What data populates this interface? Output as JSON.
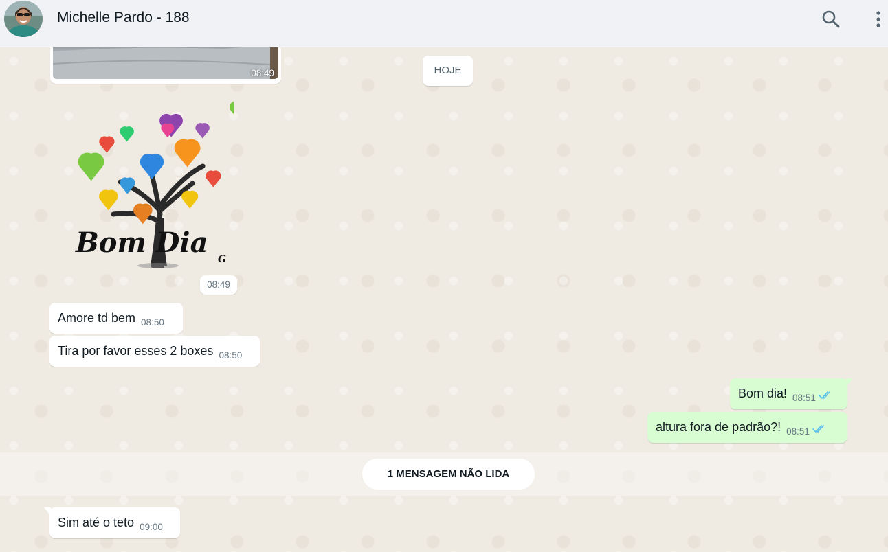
{
  "header": {
    "contact_name": "Michelle Pardo - 188",
    "search_icon": "search-icon",
    "menu_icon": "more-vertical-icon"
  },
  "chat": {
    "image_message": {
      "time": "08:49"
    },
    "day_divider": "HOJE",
    "sticker_message": {
      "sticker_text": "Bom Dia",
      "sticker_signature": "G",
      "time": "08:49"
    },
    "incoming": [
      {
        "text": "Amore td bem",
        "time": "08:50"
      },
      {
        "text": "Tira por favor esses 2 boxes",
        "time": "08:50"
      }
    ],
    "outgoing": [
      {
        "text": "Bom dia!",
        "time": "08:51"
      },
      {
        "text": "altura fora de padrão?!",
        "time": "08:51"
      }
    ],
    "unread_divider": "1 MENSAGEM NÃO LIDA",
    "last_incoming": {
      "text": "Sim até o teto",
      "time": "09:00"
    }
  },
  "colors": {
    "incoming_bubble": "#ffffff",
    "outgoing_bubble": "#d9fdd3",
    "read_ticks": "#53bdeb",
    "chat_background": "#efeae2",
    "header_background": "#f0f2f5"
  }
}
